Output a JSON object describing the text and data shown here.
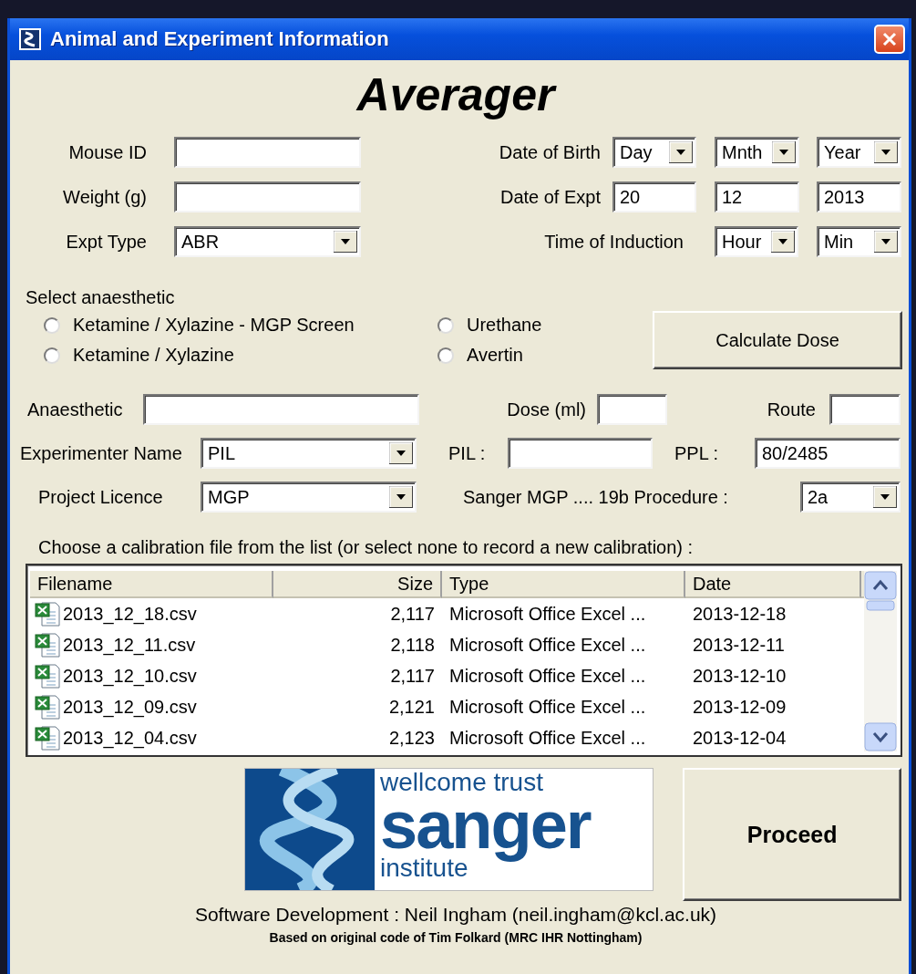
{
  "window": {
    "title": "Animal and Experiment Information"
  },
  "heading": "Averager",
  "top_rows": [
    {
      "left": {
        "label": "Mouse ID",
        "kind": "text"
      },
      "right": {
        "label": "Date of Birth",
        "inputs": [
          {
            "kind": "combo",
            "value": "Day"
          },
          {
            "kind": "combo",
            "value": "Mnth"
          },
          {
            "kind": "combo",
            "value": "Year"
          }
        ]
      }
    },
    {
      "left": {
        "label": "Weight (g)",
        "kind": "text"
      },
      "right": {
        "label": "Date of Expt",
        "inputs": [
          {
            "kind": "text",
            "value": "20"
          },
          {
            "kind": "text",
            "value": "12"
          },
          {
            "kind": "text",
            "value": "2013"
          }
        ]
      }
    },
    {
      "left": {
        "label": "Expt Type",
        "kind": "combo",
        "value": "ABR"
      },
      "right": {
        "label": "Time of Induction",
        "inputs": [
          {
            "kind": "combo",
            "value": "Hour"
          },
          {
            "kind": "combo",
            "value": "Min"
          }
        ]
      }
    }
  ],
  "anaesthetic_choice": {
    "label": "Select anaesthetic",
    "options": [
      {
        "label": "Ketamine / Xylazine - MGP Screen",
        "selected": false
      },
      {
        "label": "Ketamine / Xylazine",
        "selected": false
      },
      {
        "label": "Urethane",
        "selected": false
      },
      {
        "label": "Avertin",
        "selected": false
      }
    ],
    "button": "Calculate Dose"
  },
  "detail_rows": [
    [
      {
        "label": "Anaesthetic",
        "kind": "text"
      },
      {
        "label": "Dose (ml)",
        "kind": "text"
      },
      {
        "label": "Route",
        "kind": "text"
      }
    ],
    [
      {
        "label": "Experimenter Name",
        "kind": "combo",
        "value": "PIL"
      },
      {
        "label": "PIL :",
        "kind": "text"
      },
      {
        "label": "PPL :",
        "kind": "text",
        "value": "80/2485"
      }
    ],
    [
      {
        "label": "Project Licence",
        "kind": "combo",
        "value": "MGP"
      },
      {
        "label": "Sanger MGP .... 19b Procedure :",
        "kind": "combo",
        "value": "2a"
      }
    ]
  ],
  "calibration": {
    "prompt": "Choose a calibration file from the list (or select none to record a new calibration) :",
    "columns": [
      "Filename",
      "Size",
      "Type",
      "Date"
    ],
    "rows": [
      [
        "2013_12_18.csv",
        "2,117",
        "Microsoft Office Excel ...",
        "2013-12-18"
      ],
      [
        "2013_12_11.csv",
        "2,118",
        "Microsoft Office Excel ...",
        "2013-12-11"
      ],
      [
        "2013_12_10.csv",
        "2,117",
        "Microsoft Office Excel ...",
        "2013-12-10"
      ],
      [
        "2013_12_09.csv",
        "2,121",
        "Microsoft Office Excel ...",
        "2013-12-09"
      ],
      [
        "2013_12_04.csv",
        "2,123",
        "Microsoft Office Excel ...",
        "2013-12-04"
      ]
    ]
  },
  "logo": {
    "line_1": "wellcome trust",
    "line_2": "sanger",
    "line_3": "institute"
  },
  "proceed_button": "Proceed",
  "credits": [
    "Software Development : Neil Ingham (neil.ingham@kcl.ac.uk)",
    "Based on original code of Tim Folkard (MRC IHR Nottingham)"
  ]
}
